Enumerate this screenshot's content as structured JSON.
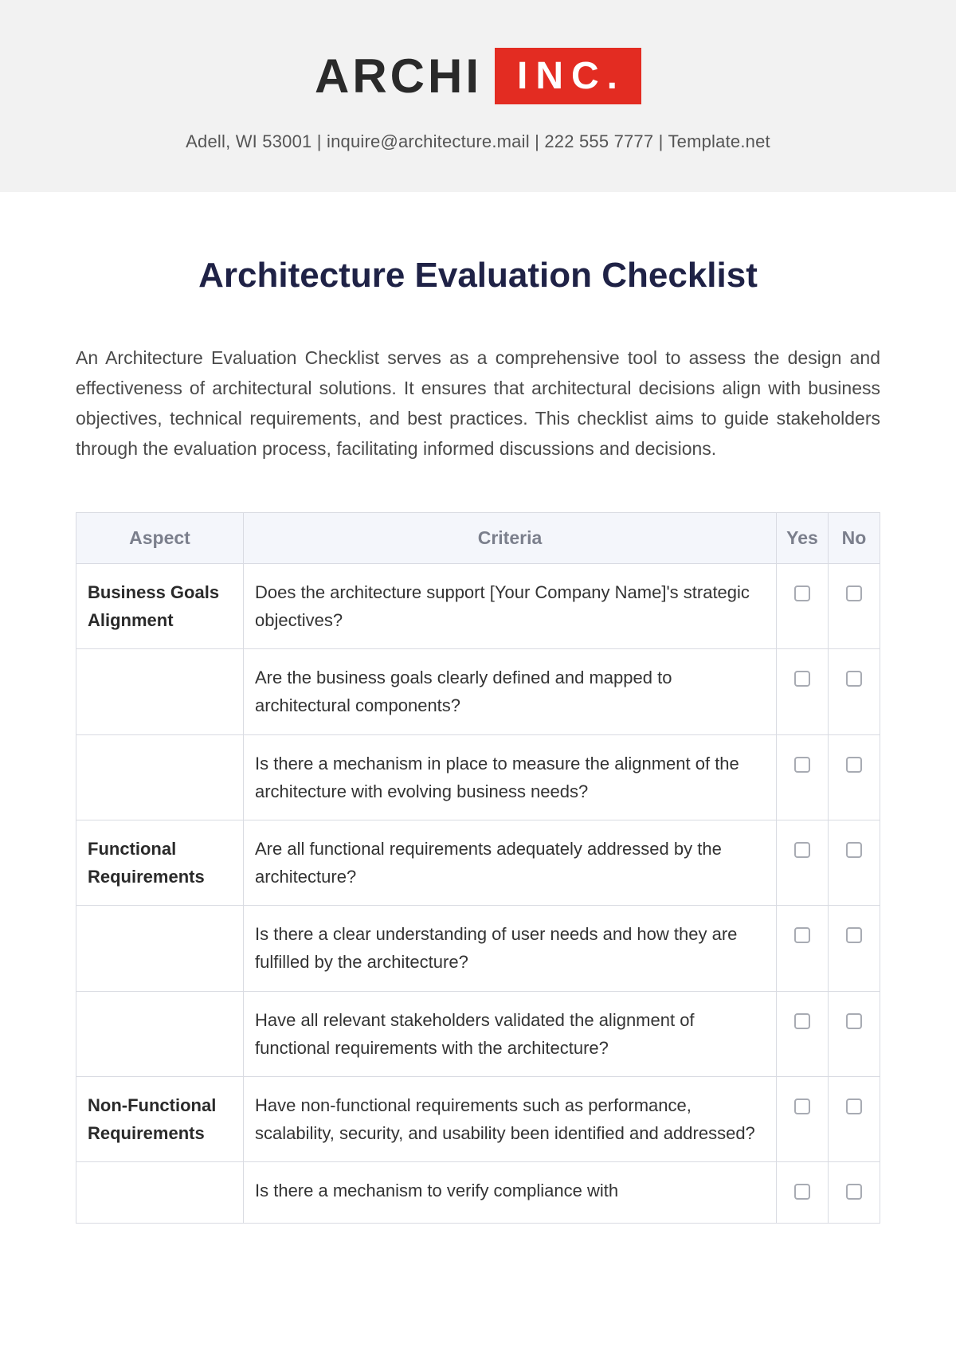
{
  "header": {
    "logo_main": "ARCHI",
    "logo_badge": "INC.",
    "contact": "Adell, WI 53001 | inquire@architecture.mail | 222 555 7777 | Template.net"
  },
  "title": "Architecture Evaluation Checklist",
  "intro": "An Architecture Evaluation Checklist serves as a comprehensive tool to assess the design and effectiveness of architectural solutions. It ensures that architectural decisions align with business objectives, technical requirements, and best practices. This checklist aims to guide stakeholders through the evaluation process, facilitating informed discussions and decisions.",
  "table": {
    "headers": {
      "aspect": "Aspect",
      "criteria": "Criteria",
      "yes": "Yes",
      "no": "No"
    },
    "rows": [
      {
        "aspect": "Business Goals Alignment",
        "criteria": "Does the architecture support [Your Company Name]'s strategic objectives?"
      },
      {
        "aspect": "",
        "criteria": "Are the business goals clearly defined and mapped to architectural components?"
      },
      {
        "aspect": "",
        "criteria": "Is there a mechanism in place to measure the alignment of the architecture with evolving business needs?"
      },
      {
        "aspect": "Functional Requirements",
        "criteria": "Are all functional requirements adequately addressed by the architecture?"
      },
      {
        "aspect": "",
        "criteria": "Is there a clear understanding of user needs and how they are fulfilled by the architecture?"
      },
      {
        "aspect": "",
        "criteria": "Have all relevant stakeholders validated the alignment of functional requirements with the architecture?"
      },
      {
        "aspect": "Non-Functional Requirements",
        "criteria": "Have non-functional requirements such as performance, scalability, security, and usability been identified and addressed?"
      },
      {
        "aspect": "",
        "criteria": "Is there a mechanism to verify compliance with"
      }
    ]
  }
}
